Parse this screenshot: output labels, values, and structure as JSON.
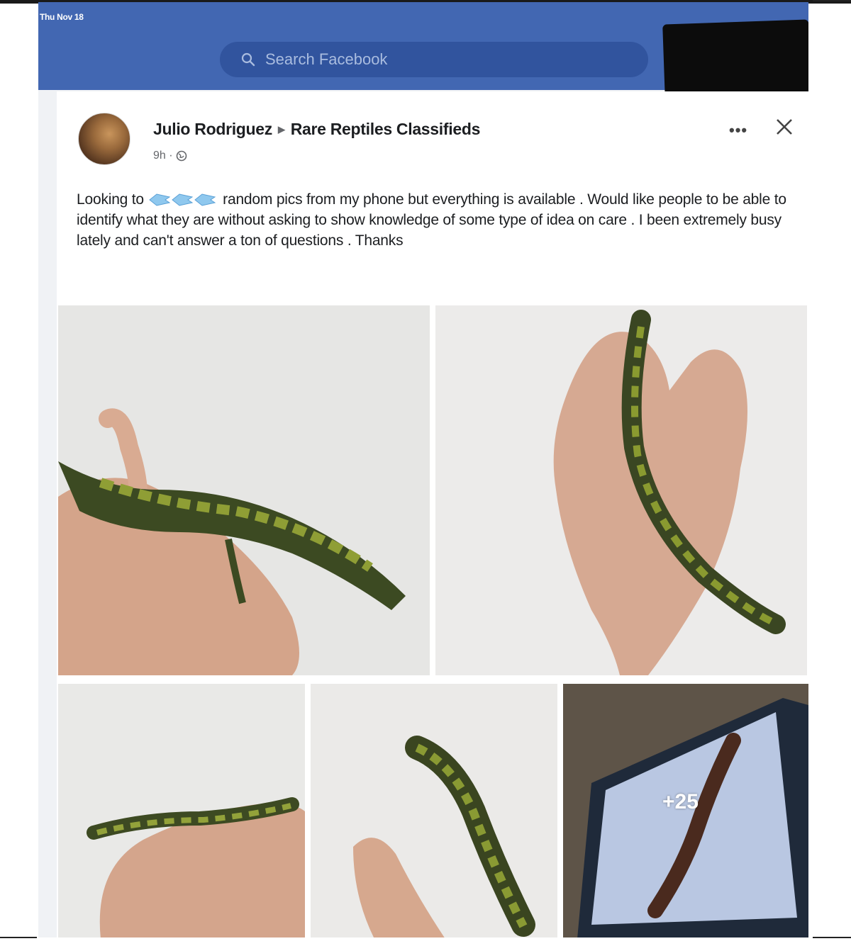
{
  "status_bar": {
    "time": "Thu Nov 18"
  },
  "header": {
    "search": {
      "placeholder": "Search Facebook"
    }
  },
  "post": {
    "author": "Julio Rodriguez",
    "group": "Rare Reptiles Classifieds",
    "time": "9h ·",
    "text_before_emoji": "Looking to ",
    "emoji": "fish-emoji",
    "text_after_emoji": " random pics from my phone but everything is available . Would like people to be able to identify what they are without asking to show knowledge of some type of idea on care . I been extremely busy lately and can't answer a ton of questions . Thanks",
    "photos_more_count": "+25"
  },
  "colors": {
    "header_bg": "#4267b2",
    "search_bg": "#31549e",
    "page_bg": "#f0f2f5",
    "card_bg": "#ffffff"
  }
}
